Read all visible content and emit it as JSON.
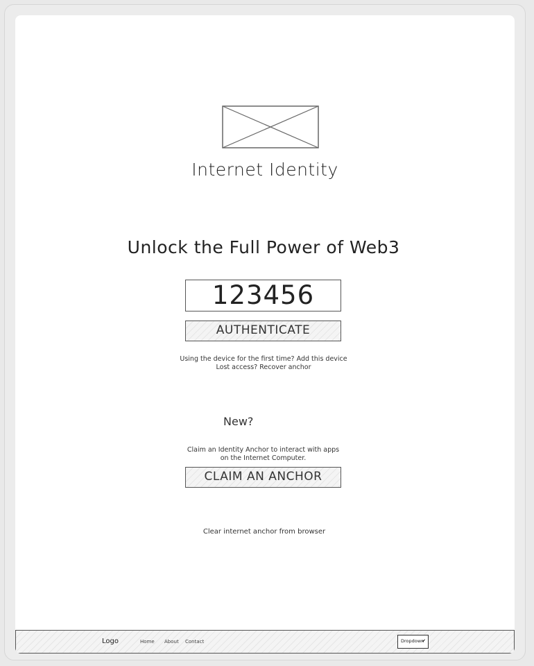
{
  "header": {
    "app_title": "Internet Identity"
  },
  "main": {
    "headline": "Unlock the Full Power of Web3",
    "anchor_value": "123456",
    "authenticate_label": "AUTHENTICATE",
    "first_time_prompt": "Using the device for the first time?",
    "add_device_link": "Add this device",
    "lost_access_prompt": "Lost access?",
    "recover_link": "Recover anchor"
  },
  "new_section": {
    "label": "New?",
    "description": "Claim an Identity Anchor to interact with apps on the Internet Computer.",
    "claim_label": "CLAIM AN ANCHOR"
  },
  "clear_link": "Clear internet anchor from browser",
  "footer": {
    "logo": "Logo",
    "nav": [
      "Home",
      "About",
      "Contact"
    ],
    "dropdown": "Dropdown"
  },
  "icons": {
    "logo_placeholder": "image-placeholder-icon",
    "dropdown_caret": "chevron-down-icon"
  }
}
